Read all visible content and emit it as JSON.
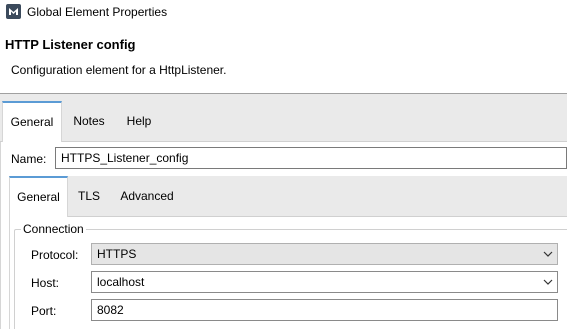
{
  "window": {
    "title": "Global Element Properties"
  },
  "header": {
    "title": "HTTP Listener config",
    "description": "Configuration element for a HttpListener."
  },
  "outer_tabs": [
    {
      "label": "General",
      "active": true
    },
    {
      "label": "Notes",
      "active": false
    },
    {
      "label": "Help",
      "active": false
    }
  ],
  "name": {
    "label": "Name:",
    "value": "HTTPS_Listener_config"
  },
  "inner_tabs": [
    {
      "label": "General",
      "active": true
    },
    {
      "label": "TLS",
      "active": false
    },
    {
      "label": "Advanced",
      "active": false
    }
  ],
  "connection": {
    "group_label": "Connection",
    "protocol": {
      "label": "Protocol:",
      "value": "HTTPS",
      "icon": "chevron-down-icon"
    },
    "host": {
      "label": "Host:",
      "value": "localhost",
      "icon": "chevron-down-icon"
    },
    "port": {
      "label": "Port:",
      "value": "8082"
    }
  },
  "colors": {
    "tab_accent": "#5b9bd5",
    "tab_strip": "#eaeaea"
  }
}
